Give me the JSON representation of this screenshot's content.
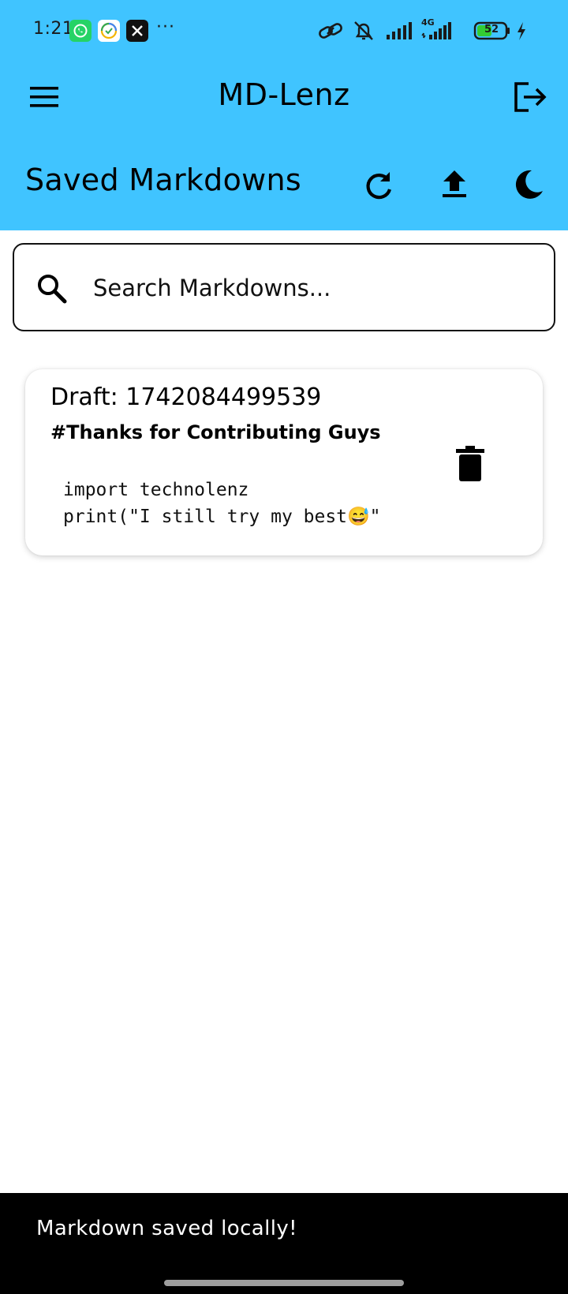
{
  "status_bar": {
    "time": "1:21",
    "more": "···",
    "battery_level": "52",
    "network_label": "4G"
  },
  "app_bar": {
    "title": "MD-Lenz",
    "menu_icon": "hamburger-menu-icon",
    "logout_icon": "logout-icon"
  },
  "toolbar": {
    "title": "Saved Markdowns",
    "refresh_icon": "refresh-icon",
    "upload_icon": "upload-icon",
    "theme_icon": "dark-mode-moon-icon"
  },
  "search": {
    "placeholder": "Search Markdowns...",
    "value": ""
  },
  "markdowns": [
    {
      "title": "Draft: 1742084499539",
      "heading": "#Thanks for Contributing Guys",
      "code": "import technolenz\nprint(\"I still try my best😅\""
    }
  ],
  "snackbar": {
    "message": "Markdown saved locally!"
  },
  "colors": {
    "header_background": "#40C4FF",
    "snackbar_background": "#000000",
    "card_background": "#FFFFFF"
  }
}
